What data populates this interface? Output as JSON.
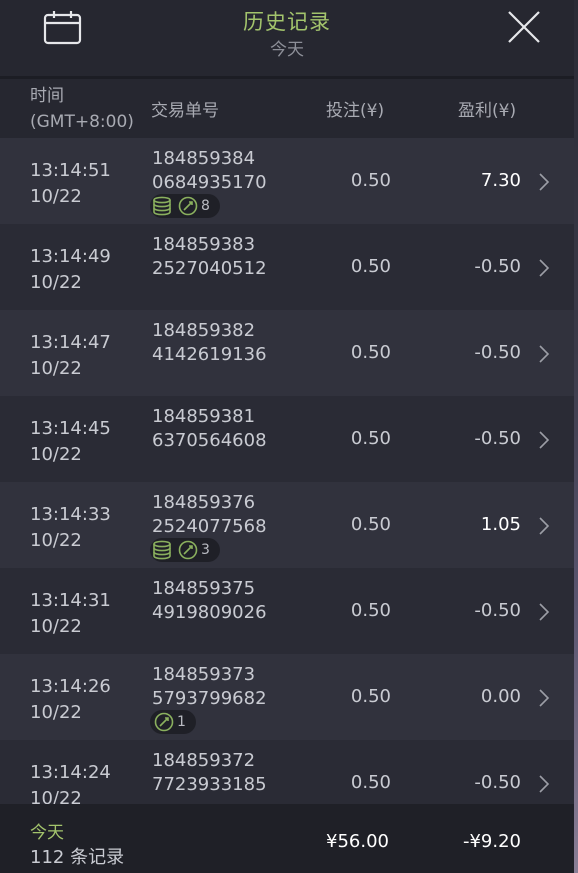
{
  "header": {
    "title": "历史记录",
    "subtitle": "今天"
  },
  "columns": {
    "time_line1": "时间",
    "time_line2": "(GMT+8:00)",
    "id": "交易单号",
    "bet": "投注(¥)",
    "profit": "盈利(¥)"
  },
  "rows": [
    {
      "time": "13:14:51",
      "date": "10/22",
      "id1": "184859384",
      "id2": "0684935170",
      "bet": "0.50",
      "profit": "7.30",
      "badge_count": "8",
      "badge_coins": true
    },
    {
      "time": "13:14:49",
      "date": "10/22",
      "id1": "184859383",
      "id2": "2527040512",
      "bet": "0.50",
      "profit": "-0.50"
    },
    {
      "time": "13:14:47",
      "date": "10/22",
      "id1": "184859382",
      "id2": "4142619136",
      "bet": "0.50",
      "profit": "-0.50"
    },
    {
      "time": "13:14:45",
      "date": "10/22",
      "id1": "184859381",
      "id2": "6370564608",
      "bet": "0.50",
      "profit": "-0.50"
    },
    {
      "time": "13:14:33",
      "date": "10/22",
      "id1": "184859376",
      "id2": "2524077568",
      "bet": "0.50",
      "profit": "1.05",
      "badge_count": "3",
      "badge_coins": true
    },
    {
      "time": "13:14:31",
      "date": "10/22",
      "id1": "184859375",
      "id2": "4919809026",
      "bet": "0.50",
      "profit": "-0.50"
    },
    {
      "time": "13:14:26",
      "date": "10/22",
      "id1": "184859373",
      "id2": "5793799682",
      "bet": "0.50",
      "profit": "0.00",
      "badge_count": "1",
      "badge_coins": false
    },
    {
      "time": "13:14:24",
      "date": "10/22",
      "id1": "184859372",
      "id2": "7723933185",
      "bet": "0.50",
      "profit": "-0.50"
    }
  ],
  "footer": {
    "label": "今天",
    "count": "112 条记录",
    "total_bet": "¥56.00",
    "total_profit": "-¥9.20"
  },
  "colors": {
    "accent_green": "#a3c46c",
    "positive_profit": "#ffffff",
    "text": "#c9cbd2"
  }
}
